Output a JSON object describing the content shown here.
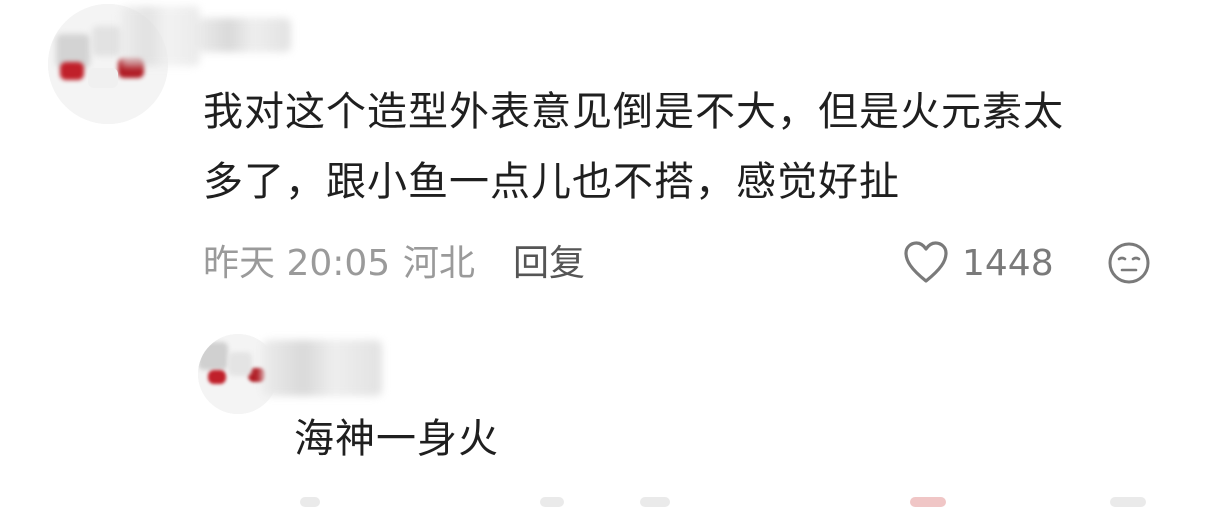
{
  "comments": [
    {
      "text_line1": "我对这个造型外表意见倒是不大，但是火元素太",
      "text_line2": "多了，跟小鱼一点儿也不搭，感觉好扯",
      "time": "昨天 20:05",
      "location": "河北",
      "reply_label": "回复",
      "likes": "1448"
    }
  ],
  "replies": [
    {
      "text": "海神一身火"
    }
  ],
  "colors": {
    "accent_avatar": "#c0202a",
    "meta_text": "#9a9a9a",
    "body_text": "#1f1f1f"
  },
  "icons": {
    "like": "heart-outline-icon",
    "reaction": "emoji-face-icon"
  }
}
